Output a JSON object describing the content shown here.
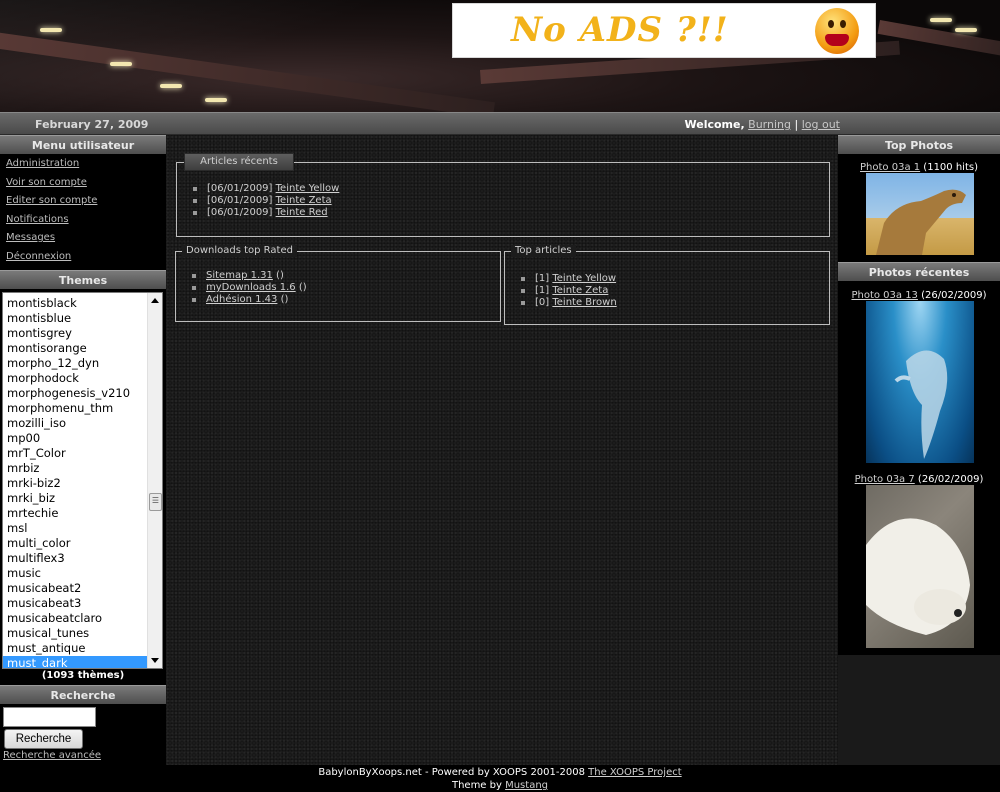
{
  "header": {
    "ad_text": "No ADS ?!!"
  },
  "topbar": {
    "date": "February 27, 2009",
    "welcome_label": "Welcome,",
    "username": "Burning",
    "separator": "|",
    "logout": "log out"
  },
  "user_menu": {
    "title": "Menu utilisateur",
    "items": [
      {
        "label": "Administration"
      },
      {
        "label": "Voir son compte"
      },
      {
        "label": "Editer son compte"
      },
      {
        "label": "Notifications"
      },
      {
        "label": "Messages"
      },
      {
        "label": "Déconnexion"
      }
    ]
  },
  "themes": {
    "title": "Themes",
    "items": [
      "montisblack",
      "montisblue",
      "montisgrey",
      "montisorange",
      "morpho_12_dyn",
      "morphodock",
      "morphogenesis_v210",
      "morphomenu_thm",
      "mozilli_iso",
      "mp00",
      "mrT_Color",
      "mrbiz",
      "mrki-biz2",
      "mrki_biz",
      "mrtechie",
      "msl",
      "multi_color",
      "multiflex3",
      "music",
      "musicabeat2",
      "musicabeat3",
      "musicabeatclaro",
      "musical_tunes",
      "must_antique",
      "must_dark"
    ],
    "selected": "must_dark",
    "count": "(1093 thèmes)"
  },
  "search": {
    "title": "Recherche",
    "input_value": "",
    "button": "Recherche",
    "advanced": "Recherche avancée"
  },
  "articles_recent": {
    "title": "Articles récents",
    "items": [
      {
        "date": "[06/01/2009]",
        "link": "Teinte Yellow"
      },
      {
        "date": "[06/01/2009]",
        "link": "Teinte Zeta"
      },
      {
        "date": "[06/01/2009]",
        "link": "Teinte Red"
      }
    ]
  },
  "downloads_top": {
    "title": "Downloads top Rated",
    "items": [
      {
        "link": "Sitemap 1.31",
        "suffix": " ()"
      },
      {
        "link": "myDownloads 1.6",
        "suffix": " ()"
      },
      {
        "link": "Adhésion 1.43",
        "suffix": " ()"
      }
    ]
  },
  "top_articles": {
    "title": "Top articles",
    "items": [
      {
        "rank": "[1]",
        "link": "Teinte Yellow"
      },
      {
        "rank": "[1]",
        "link": "Teinte Zeta"
      },
      {
        "rank": "[0]",
        "link": "Teinte Brown"
      }
    ]
  },
  "top_photos": {
    "title": "Top Photos",
    "photo": {
      "link": "Photo 03a 1",
      "info": " (1100 hits)"
    }
  },
  "recent_photos": {
    "title": "Photos récentes",
    "photos": [
      {
        "link": "Photo 03a 13",
        "info": " (26/02/2009)"
      },
      {
        "link": "Photo 03a 7",
        "info": " (26/02/2009)"
      }
    ]
  },
  "footer": {
    "line1_text": "BabylonByXoops.net - Powered by XOOPS 2001-2008 ",
    "line1_link": "The XOOPS Project",
    "line2_text": "Theme by ",
    "line2_link": "Mustang"
  },
  "colors": {
    "background": "#1c1c1c",
    "block_title": "#5e5e5e",
    "selected_theme": "#3399ff",
    "ad_text": "#f2b21a"
  }
}
